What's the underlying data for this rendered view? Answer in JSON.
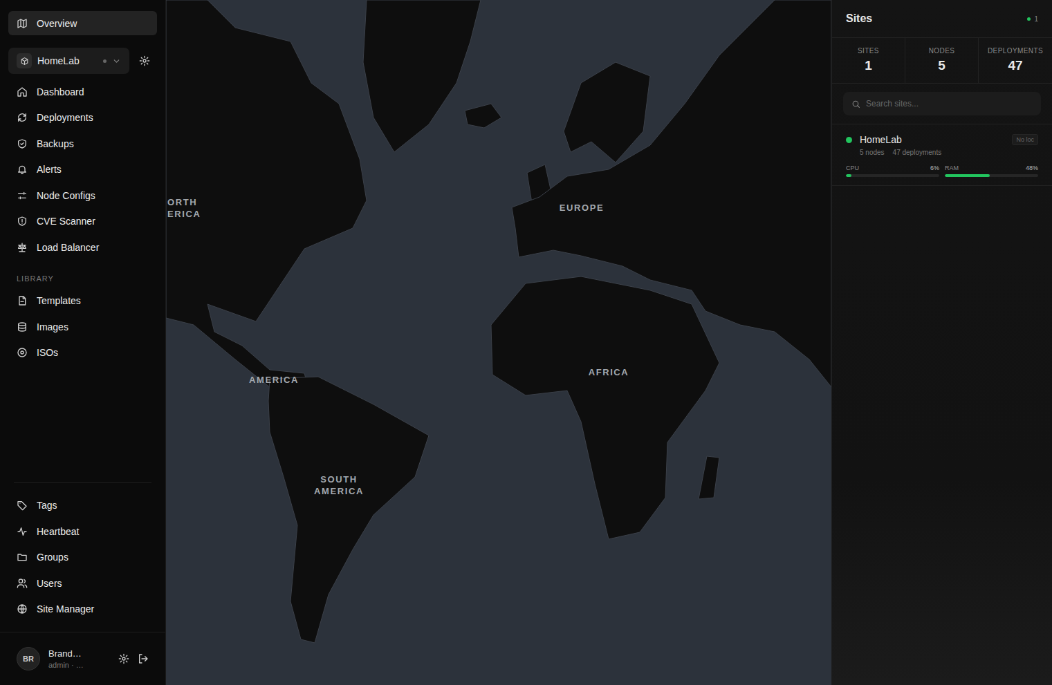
{
  "sidebar": {
    "overview": {
      "label": "Overview",
      "selected": true
    },
    "workspace": {
      "name": "HomeLab"
    },
    "main_items": [
      {
        "label": "Dashboard",
        "selected": false
      },
      {
        "label": "Deployments",
        "selected": false
      },
      {
        "label": "Backups",
        "selected": false
      },
      {
        "label": "Alerts",
        "selected": false
      },
      {
        "label": "Node Configs",
        "selected": false
      },
      {
        "label": "CVE Scanner",
        "selected": false
      },
      {
        "label": "Load Balancer",
        "selected": false
      }
    ],
    "library_heading": "LIBRARY",
    "library_items": [
      {
        "label": "Templates",
        "selected": false
      },
      {
        "label": "Images",
        "selected": false
      },
      {
        "label": "ISOs",
        "selected": false
      }
    ],
    "bottom_items": [
      {
        "label": "Tags",
        "selected": false
      },
      {
        "label": "Heartbeat",
        "selected": false
      },
      {
        "label": "Groups",
        "selected": false
      },
      {
        "label": "Users",
        "selected": false
      },
      {
        "label": "Site Manager",
        "selected": false
      }
    ],
    "user": {
      "initials": "BR",
      "name": "Brand…",
      "role": "admin · …"
    }
  },
  "map": {
    "labels": [
      {
        "lines": [
          "ORTH",
          "ERICA"
        ]
      },
      {
        "lines": [
          "EUROPE"
        ]
      },
      {
        "lines": [
          "AMERICA"
        ]
      },
      {
        "lines": [
          "SOUTH",
          "AMERICA"
        ]
      },
      {
        "lines": [
          "AFRICA"
        ]
      }
    ]
  },
  "panel": {
    "title": "Sites",
    "status_count": "1",
    "stats": [
      {
        "label": "SITES",
        "value": "1"
      },
      {
        "label": "NODES",
        "value": "5"
      },
      {
        "label": "DEPLOYMENTS",
        "value": "47"
      }
    ],
    "search": {
      "placeholder": "Search sites..."
    },
    "sites": [
      {
        "name": "HomeLab",
        "color": "#22c55e",
        "badge": "No loc",
        "nodes": "5 nodes",
        "deployments": "47 deployments",
        "metrics": [
          {
            "label": "CPU",
            "reading": "6%",
            "level": 0.06
          },
          {
            "label": "RAM",
            "reading": "48%",
            "level": 0.48
          }
        ]
      }
    ]
  }
}
